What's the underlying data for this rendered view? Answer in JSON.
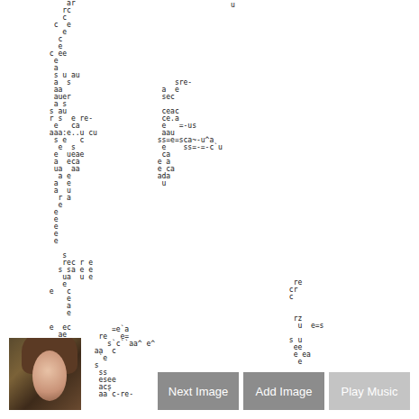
{
  "art": {
    "strands": [
      "     ar\n    rc\n    c\n  c  e\n    e\n   c\n   e\n c ee\n  e\n  a\n  s u au\n  a  s\n  aa\n  auer\n  a s\n s au\n r s  e re-\n  e   ca\n aaa:e..u cu\n  s e   c\n   e  s\n  e  ueae\n  a  eca\n  ua  aa\n   a e\n  a  e\n  a  u\n   r a\n   e\n  e\n  e\n  e\n  e\n  e\n\n    s\n    rec r e\n   s sa e e\n    ua  u e\n    e\n e   c\n     e\n     a\n     e\n\n e  ec\n   ae",
      "      sre-\n   a  e\n   sec\n\n   ceac\n   ce.a\n   e   =-us\n   aau\n  ss=e=sca~-u^a\n   e    ss=-=-c`u\n   ca\n  e a\n  e ca\n  ada\n   u",
      "  re\n cr\n c\n\n\n  rz\n   u  e=s\n\n s u\n  ee\n  e ea\n   e",
      "      =e`a\n   re   e=\n     s`c``aa^ e^\n  aa  c\n   `e\n  s\n   ss\n   esee\n   acs\n   aa`c-re-",
      "u"
    ]
  },
  "buttons": [
    {
      "label": "Next Image",
      "disabled": false
    },
    {
      "label": "Add Image",
      "disabled": false
    },
    {
      "label": "Play Music",
      "disabled": true
    }
  ]
}
